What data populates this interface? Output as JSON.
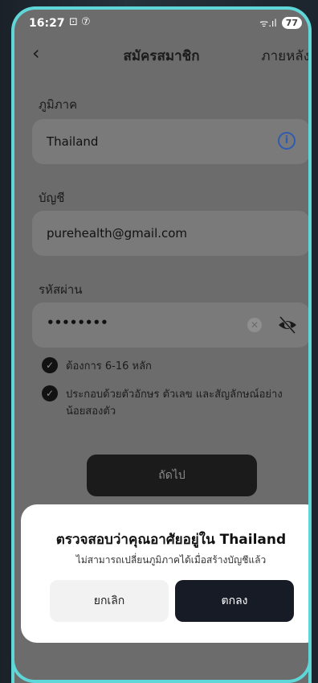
{
  "status_bar": {
    "time": "16:27",
    "icons": "⊡ ⑦",
    "signal": "ᯤ.ıl",
    "battery": "77"
  },
  "header": {
    "back": "‹",
    "title": "สมัครสมาชิก",
    "later": "ภายหลัง"
  },
  "region": {
    "label": "ภูมิภาค",
    "value": "Thailand"
  },
  "account": {
    "label": "บัญชี",
    "value": "purehealth@gmail.com"
  },
  "password": {
    "label": "รหัสผ่าน",
    "value": "••••••••"
  },
  "rules": [
    {
      "text": "ต้องการ 6-16 หลัก"
    },
    {
      "text": "ประกอบด้วยตัวอักษร ตัวเลข และสัญลักษณ์อย่างน้อยสองตัว"
    }
  ],
  "next_button": "ถัดไป",
  "dialog": {
    "title": "ตรวจสอบว่าคุณอาศัยอยู่ใน Thailand",
    "subtitle": "ไม่สามารถเปลี่ยนภูมิภาคได้เมื่อสร้างบัญชีแล้ว",
    "cancel": "ยกเลิก",
    "confirm": "ตกลง"
  },
  "colors": {
    "accent_frame": "#5fd6d8",
    "info_icon": "#2f5bb1",
    "confirm_bg": "#171b25"
  }
}
